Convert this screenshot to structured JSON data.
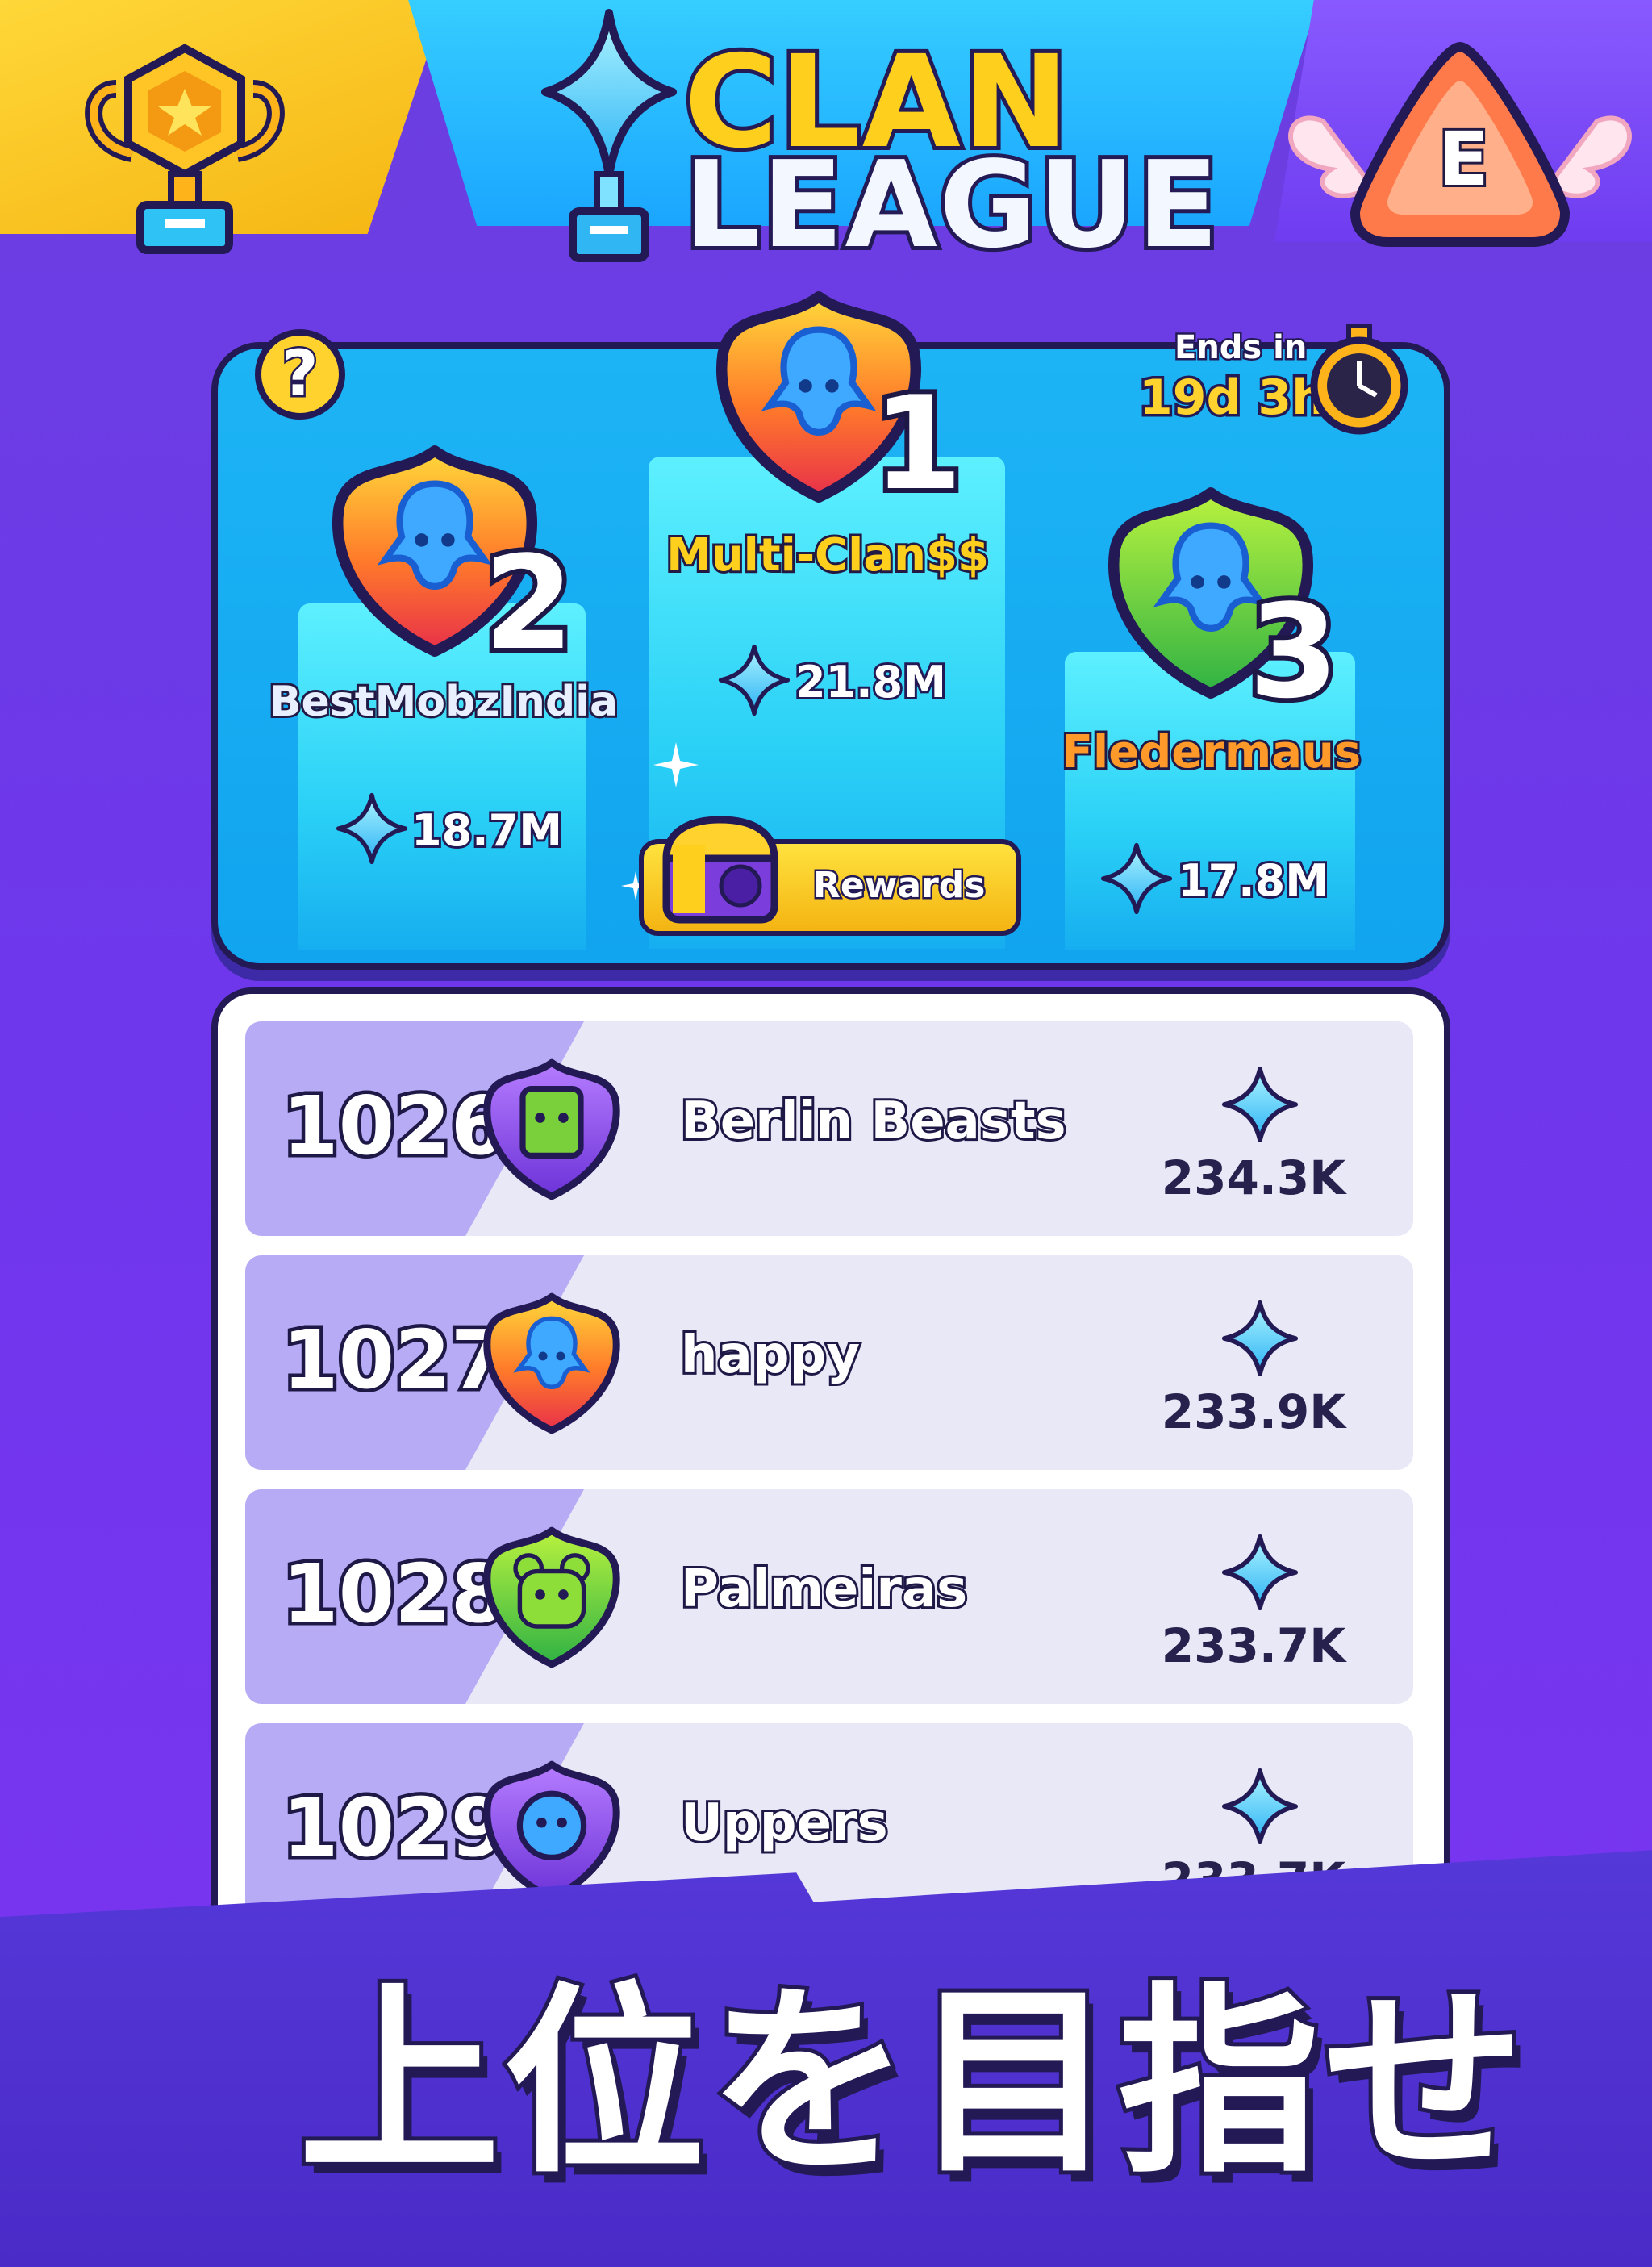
{
  "header": {
    "title_line1": "CLAN",
    "title_line2": "LEAGUE",
    "league_badge_letter": "E"
  },
  "podium": {
    "help_label": "?",
    "ends_label": "Ends in",
    "ends_value": "19d 3h",
    "rewards_label": "Rewards",
    "first": {
      "rank": "1",
      "name": "Multi-Clan$$",
      "score": "21.8M"
    },
    "second": {
      "rank": "2",
      "name": "BestMobzIndia",
      "score": "18.7M"
    },
    "third": {
      "rank": "3",
      "name": "Fledermaus",
      "score": "17.8M"
    }
  },
  "leaderboard": {
    "rows": [
      {
        "rank": "1026",
        "name": "Berlin Beasts",
        "score": "234.3K",
        "badge": "purple-green-emblem-icon"
      },
      {
        "rank": "1027",
        "name": "happy",
        "score": "233.9K",
        "badge": "red-octopus-emblem-icon"
      },
      {
        "rank": "1028",
        "name": "Palmeiras",
        "score": "233.7K",
        "badge": "green-bear-emblem-icon"
      },
      {
        "rank": "1029",
        "name": "Uppers",
        "score": "233.7K",
        "badge": "purple-blue-emblem-icon"
      }
    ]
  },
  "banner": {
    "text": "上位を目指せ"
  },
  "colors": {
    "background": "#6e37ec",
    "panel_blue": "#13a8f0",
    "gold": "#ffcf1d",
    "outline": "#231a55",
    "row_bg": "#e8e8f7"
  }
}
